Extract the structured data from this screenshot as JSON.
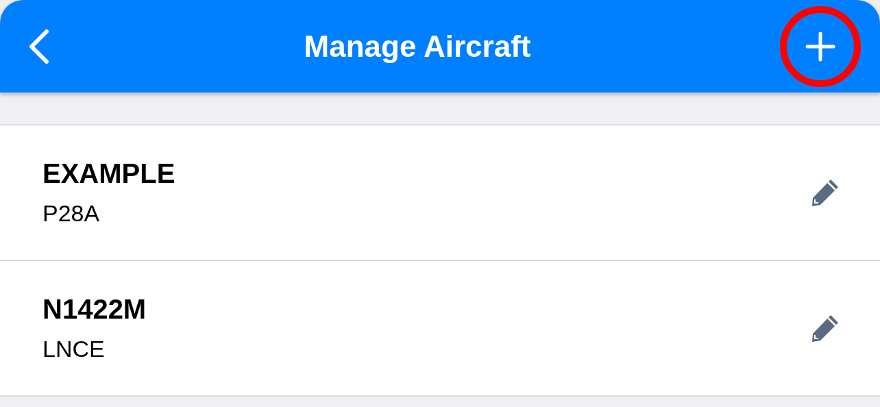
{
  "header": {
    "title": "Manage Aircraft",
    "add_button": {
      "highlighted": true
    }
  },
  "aircraft": [
    {
      "name": "EXAMPLE",
      "type": "P28A"
    },
    {
      "name": "N1422M",
      "type": "LNCE"
    }
  ]
}
